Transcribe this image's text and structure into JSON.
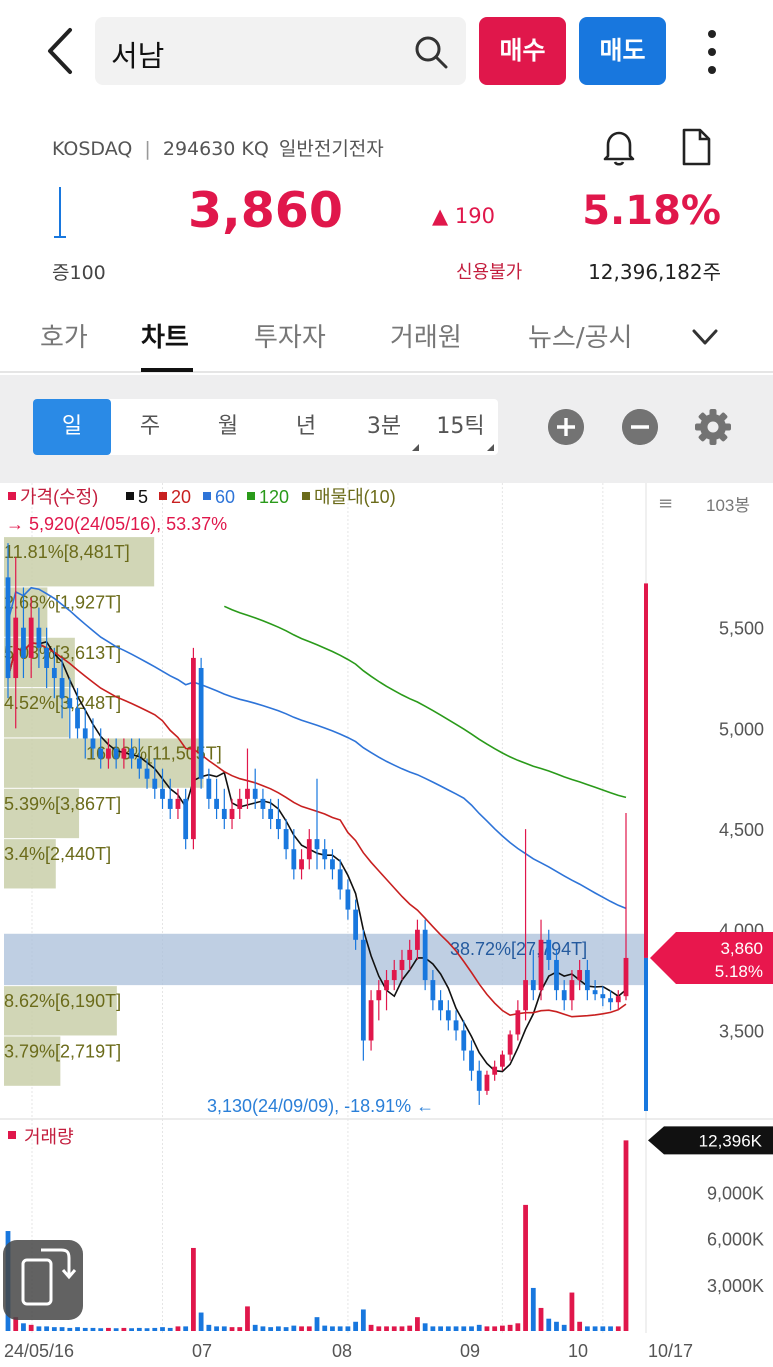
{
  "header": {
    "search_text": "서남",
    "buy_label": "매수",
    "sell_label": "매도"
  },
  "quote": {
    "market": "KOSDAQ",
    "code": "294630 KQ",
    "sector": "일반전기전자",
    "price": "3,860",
    "change": "190",
    "change_pct": "5.18%",
    "margin": "증100",
    "credit": "신용불가",
    "volume": "12,396,182주"
  },
  "tabs": [
    "호가",
    "차트",
    "투자자",
    "거래원",
    "뉴스/공시"
  ],
  "active_tab": "차트",
  "periods": [
    "일",
    "주",
    "월",
    "년",
    "3분",
    "15틱"
  ],
  "active_period": "일",
  "colors": {
    "up": "#e0174b",
    "down": "#1877de",
    "ma5": "#111111",
    "ma20": "#c82020",
    "ma60": "#2e74d8",
    "ma120": "#2a9a1a",
    "volume_profile": "#7a7a22"
  },
  "chart_data": {
    "type": "candlestick",
    "legend": [
      {
        "label": "가격(수정)",
        "color": "#e0174b"
      },
      {
        "label": "5",
        "color": "#111111"
      },
      {
        "label": "20",
        "color": "#c82020"
      },
      {
        "label": "60",
        "color": "#2e74d8"
      },
      {
        "label": "120",
        "color": "#2a9a1a"
      },
      {
        "label": "매물대(10)",
        "color": "#6b6b1a"
      }
    ],
    "bar_count_label": "103봉",
    "high_annotation": "5,920(24/05/16), 53.37%",
    "low_annotation": "3,130(24/09/09), -18.91%",
    "ylim": [
      3080,
      6020
    ],
    "y_ticks": [
      3500,
      4000,
      4500,
      5000,
      5500
    ],
    "y_tick_labels": [
      "3,500",
      "4,000",
      "4,500",
      "5,000",
      "5,500"
    ],
    "current_price_tag": {
      "price": "3,860",
      "pct": "5.18%",
      "value": 3860
    },
    "x_labels": [
      "24/05/16",
      "07",
      "08",
      "09",
      "10",
      "10/17"
    ],
    "volume_profile": [
      {
        "low": 5700,
        "high": 5950,
        "label": "11.81%[8,481T]",
        "pct": 11.81
      },
      {
        "low": 5450,
        "high": 5700,
        "label": "2.68%[1,927T]",
        "pct": 2.68
      },
      {
        "low": 5200,
        "high": 5450,
        "label": "5.03%[3,613T]",
        "pct": 5.03
      },
      {
        "low": 4950,
        "high": 5200,
        "label": "4.52%[3,248T]",
        "pct": 4.52
      },
      {
        "low": 4700,
        "high": 4950,
        "label": "16.03%[11,505T]",
        "pct": 16.03
      },
      {
        "low": 4450,
        "high": 4700,
        "label": "5.39%[3,867T]",
        "pct": 5.39
      },
      {
        "low": 4200,
        "high": 4450,
        "label": "3.4%[2,440T]",
        "pct": 3.4
      },
      {
        "low": 3720,
        "high": 3980,
        "label": "38.72%[27,794T]",
        "pct": 38.72
      },
      {
        "low": 3470,
        "high": 3720,
        "label": "8.62%[6,190T]",
        "pct": 8.62
      },
      {
        "low": 3220,
        "high": 3470,
        "label": "3.79%[2,719T]",
        "pct": 3.79
      }
    ],
    "candles_ohlc": [
      [
        5750,
        5920,
        5150,
        5250
      ],
      [
        5250,
        5850,
        5000,
        5550
      ],
      [
        5500,
        5700,
        5250,
        5350
      ],
      [
        5350,
        5650,
        5250,
        5550
      ],
      [
        5500,
        5600,
        5300,
        5400
      ],
      [
        5400,
        5500,
        5200,
        5300
      ],
      [
        5300,
        5400,
        5150,
        5250
      ],
      [
        5250,
        5350,
        5050,
        5150
      ],
      [
        5150,
        5250,
        4950,
        5100
      ],
      [
        5100,
        5200,
        4950,
        5000
      ],
      [
        5000,
        5100,
        4850,
        4950
      ],
      [
        4950,
        5050,
        4850,
        4900
      ],
      [
        4900,
        5000,
        4800,
        4850
      ],
      [
        4850,
        4950,
        4800,
        4900
      ],
      [
        4900,
        4950,
        4800,
        4850
      ],
      [
        4850,
        4950,
        4800,
        4900
      ],
      [
        4900,
        4950,
        4800,
        4850
      ],
      [
        4850,
        4950,
        4750,
        4800
      ],
      [
        4800,
        4850,
        4700,
        4750
      ],
      [
        4750,
        4850,
        4650,
        4700
      ],
      [
        4700,
        4800,
        4600,
        4650
      ],
      [
        4650,
        4750,
        4550,
        4600
      ],
      [
        4600,
        4700,
        4550,
        4650
      ],
      [
        4650,
        4700,
        4400,
        4450
      ],
      [
        4450,
        5400,
        4400,
        5350
      ],
      [
        5300,
        5350,
        4700,
        4750
      ],
      [
        4750,
        4800,
        4600,
        4650
      ],
      [
        4650,
        4750,
        4550,
        4600
      ],
      [
        4600,
        4700,
        4500,
        4550
      ],
      [
        4550,
        4650,
        4500,
        4600
      ],
      [
        4600,
        4700,
        4550,
        4650
      ],
      [
        4650,
        4900,
        4600,
        4700
      ],
      [
        4700,
        4800,
        4600,
        4650
      ],
      [
        4650,
        4700,
        4550,
        4600
      ],
      [
        4600,
        4650,
        4500,
        4550
      ],
      [
        4550,
        4650,
        4450,
        4500
      ],
      [
        4500,
        4550,
        4350,
        4400
      ],
      [
        4400,
        4500,
        4250,
        4300
      ],
      [
        4300,
        4400,
        4250,
        4350
      ],
      [
        4350,
        4500,
        4300,
        4450
      ],
      [
        4450,
        4750,
        4300,
        4400
      ],
      [
        4400,
        4450,
        4300,
        4350
      ],
      [
        4350,
        4400,
        4250,
        4300
      ],
      [
        4300,
        4350,
        4150,
        4200
      ],
      [
        4200,
        4250,
        4050,
        4100
      ],
      [
        4100,
        4150,
        3900,
        3950
      ],
      [
        3950,
        4000,
        3350,
        3450
      ],
      [
        3450,
        3700,
        3400,
        3650
      ],
      [
        3650,
        3750,
        3550,
        3700
      ],
      [
        3700,
        3800,
        3600,
        3750
      ],
      [
        3750,
        3850,
        3700,
        3800
      ],
      [
        3800,
        3900,
        3750,
        3850
      ],
      [
        3850,
        3950,
        3800,
        3900
      ],
      [
        3900,
        4050,
        3850,
        4000
      ],
      [
        4000,
        4050,
        3700,
        3750
      ],
      [
        3750,
        3800,
        3600,
        3650
      ],
      [
        3650,
        3700,
        3550,
        3600
      ],
      [
        3600,
        3650,
        3500,
        3550
      ],
      [
        3550,
        3600,
        3450,
        3500
      ],
      [
        3500,
        3550,
        3350,
        3400
      ],
      [
        3400,
        3450,
        3250,
        3300
      ],
      [
        3300,
        3350,
        3130,
        3200
      ],
      [
        3200,
        3300,
        3180,
        3280
      ],
      [
        3280,
        3350,
        3250,
        3320
      ],
      [
        3320,
        3400,
        3300,
        3380
      ],
      [
        3380,
        3500,
        3350,
        3480
      ],
      [
        3480,
        3650,
        3450,
        3600
      ],
      [
        3600,
        4500,
        3550,
        3750
      ],
      [
        3750,
        3900,
        3650,
        3700
      ],
      [
        3700,
        4050,
        3650,
        3950
      ],
      [
        3950,
        4000,
        3800,
        3850
      ],
      [
        3850,
        3900,
        3650,
        3700
      ],
      [
        3700,
        3750,
        3600,
        3650
      ],
      [
        3650,
        3800,
        3600,
        3750
      ],
      [
        3750,
        3850,
        3700,
        3800
      ],
      [
        3800,
        3850,
        3650,
        3700
      ],
      [
        3700,
        3750,
        3650,
        3680
      ],
      [
        3680,
        3720,
        3620,
        3660
      ],
      [
        3660,
        3700,
        3600,
        3640
      ],
      [
        3640,
        3700,
        3600,
        3670
      ],
      [
        3670,
        4580,
        3650,
        3860
      ]
    ],
    "volume": {
      "ylim": [
        0,
        13200
      ],
      "y_ticks": [
        3000,
        6000,
        9000
      ],
      "y_tick_labels": [
        "3,000K",
        "6,000K",
        "9,000K"
      ],
      "current_label": "12,396K",
      "current": 12396,
      "values": [
        6500,
        900,
        500,
        400,
        300,
        300,
        250,
        250,
        200,
        250,
        200,
        200,
        180,
        200,
        180,
        200,
        180,
        200,
        180,
        200,
        250,
        200,
        300,
        300,
        5400,
        1200,
        400,
        300,
        300,
        250,
        250,
        1600,
        400,
        300,
        250,
        300,
        250,
        350,
        300,
        300,
        900,
        350,
        300,
        300,
        300,
        600,
        1400,
        400,
        300,
        300,
        300,
        300,
        350,
        900,
        500,
        300,
        300,
        300,
        300,
        300,
        300,
        400,
        300,
        300,
        350,
        400,
        500,
        8200,
        2800,
        1500,
        800,
        600,
        400,
        2500,
        600,
        300,
        300,
        300,
        300,
        300,
        12396
      ]
    }
  }
}
